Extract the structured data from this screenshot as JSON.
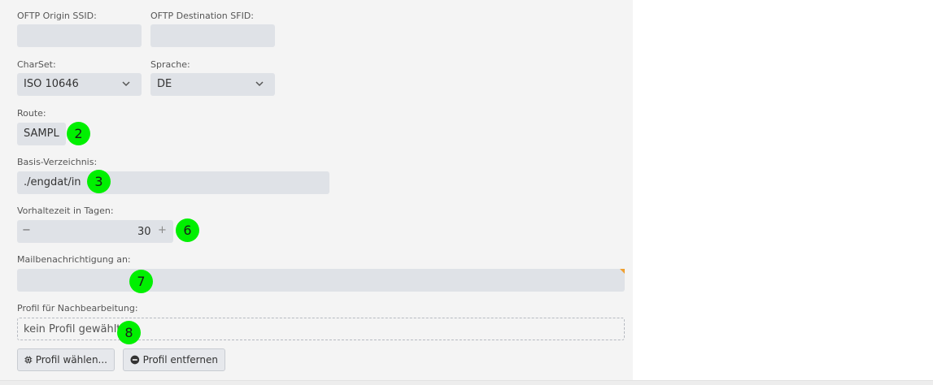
{
  "oftp_origin": {
    "label": "OFTP Origin SSID:",
    "value": ""
  },
  "oftp_destination": {
    "label": "OFTP Destination SFID:",
    "value": ""
  },
  "charset": {
    "label": "CharSet:",
    "value": "ISO 10646"
  },
  "sprache": {
    "label": "Sprache:",
    "value": "DE"
  },
  "route": {
    "label": "Route:",
    "value": "SAMPL",
    "badge": "2"
  },
  "basis": {
    "label": "Basis-Verzeichnis:",
    "value": "./engdat/in",
    "badge": "3"
  },
  "vorhaltezeit": {
    "label": "Vorhaltezeit in Tagen:",
    "value": "30",
    "minus": "−",
    "plus": "+",
    "badge": "6"
  },
  "mail": {
    "label": "Mailbenachrichtigung an:",
    "value": "",
    "badge": "7"
  },
  "profil": {
    "label": "Profil für Nachbearbeitung:",
    "value": "kein Profil gewählt",
    "badge": "8"
  },
  "buttons": {
    "choose": "Profil wählen...",
    "remove": "Profil entfernen"
  },
  "colors": {
    "badge": "#00f000",
    "field": "#dfe2e7",
    "panel": "#f4f4f4",
    "corner_flag": "#f0a030"
  }
}
